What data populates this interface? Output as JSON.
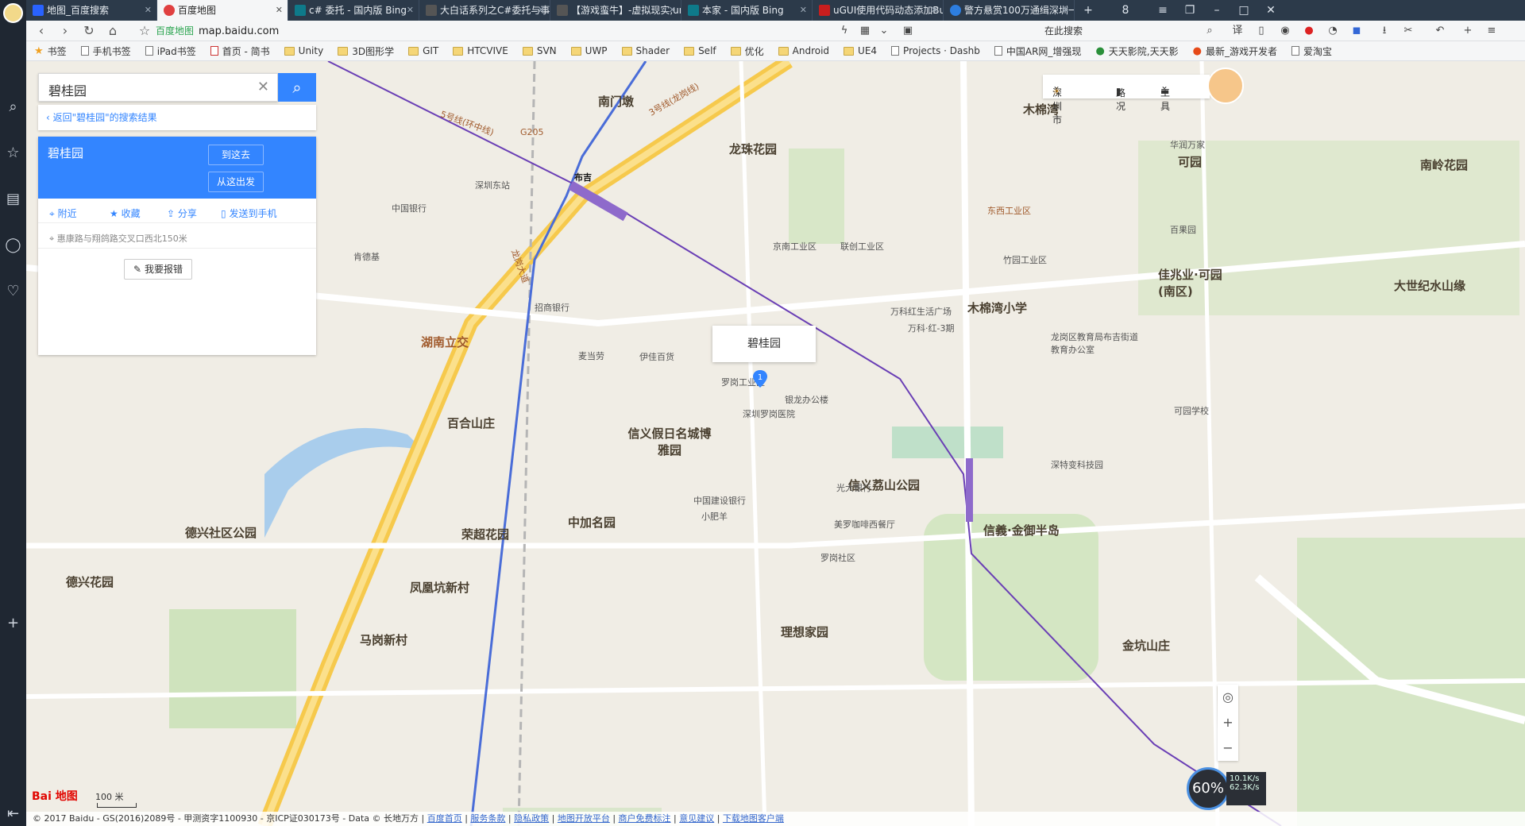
{
  "tabs": [
    {
      "label": "地图_百度搜索",
      "color": "#2962ff"
    },
    {
      "label": "百度地图",
      "color": "#e04040"
    },
    {
      "label": "c# 委托 - 国内版 Bing",
      "color": "#0e7a8a"
    },
    {
      "label": "大白话系列之C#委托与事件",
      "color": "#555555"
    },
    {
      "label": "【游戏蛮牛】-虚拟现实,unity",
      "color": "#555555"
    },
    {
      "label": "本家 - 国内版 Bing",
      "color": "#0e7a8a"
    },
    {
      "label": "uGUI使用代码动态添加Butt",
      "color": "#c81e1e"
    },
    {
      "label": "警方悬赏100万通缉深圳一名",
      "color": "#2d7ee0"
    }
  ],
  "tab_counter": "8",
  "address": {
    "site": "百度地图",
    "url": "map.baidu.com",
    "search_placeholder": "在此搜索"
  },
  "bookmarks": [
    "书签",
    "手机书签",
    "iPad书签",
    "首页 - 简书",
    "Unity",
    "3D图形学",
    "GIT",
    "HTCVIVE",
    "SVN",
    "UWP",
    "Shader",
    "Self",
    "优化",
    "Android",
    "UE4",
    "Projects · Dashb",
    "中国AR网_增强现",
    "天天影院,天天影",
    "最新_游戏开发者",
    "爱淘宝"
  ],
  "panel": {
    "search_value": "碧桂园",
    "back_link": "返回\"碧桂园\"的搜索结果",
    "place_name": "碧桂园",
    "btn_to": "到这去",
    "btn_from": "从这出发",
    "act_nearby": "附近",
    "act_fav": "收藏",
    "act_share": "分享",
    "act_send": "发送到手机",
    "address": "惠康路与翔鸽路交叉口西北150米",
    "report": "我要报错"
  },
  "tools": {
    "city": "深圳市",
    "traffic": "路况",
    "tools": "工具"
  },
  "bubble": {
    "title": "碧桂园",
    "marker": "1"
  },
  "map_labels": {
    "districts": [
      "南门墩",
      "龙珠花园",
      "木棉湾",
      "可园",
      "南岭花园",
      "佳兆业·可园(南区)",
      "大世纪水山缘",
      "木棉湾小学",
      "百合山庄",
      "信义假日名城博雅园",
      "信义荔山公园",
      "信義·金御半岛",
      "中加名园",
      "荣超花园",
      "德兴社区公园",
      "德兴花园",
      "凤凰坑新村",
      "马岗新村",
      "理想家园",
      "金坑山庄",
      "湖南立交"
    ],
    "pois": [
      "布吉",
      "深圳东站",
      "中国银行",
      "肯德基",
      "麦当劳",
      "招商银行",
      "伊佳百货",
      "深圳罗岗医院",
      "罗岗工业区",
      "银龙办公楼",
      "光大银行",
      "中国建设银行",
      "小肥羊",
      "美罗咖啡西餐厅",
      "罗岗社区",
      "深特变科技园",
      "龙岗区教育局布吉街道教育办公室",
      "可园学校",
      "华润万家",
      "百果园",
      "联创工业区",
      "京南工业区",
      "竹园工业区",
      "万科红生活广场",
      "万科·红-3期"
    ],
    "roads": [
      "5号线(环中线)",
      "3号线(龙岗线)",
      "龙岗大道",
      "G205",
      "东西工业区"
    ]
  },
  "speed": {
    "percent": "60%",
    "up": "10.1K/s",
    "down": "62.3K/s"
  },
  "scale": "100 米",
  "copyright": "© 2017 Baidu - GS(2016)2089号 - 甲测资字1100930 - 京ICP证030173号 - Data © 长地万方 |",
  "footer_links": [
    "百度首页",
    "服务条款",
    "隐私政策",
    "地图开放平台",
    "商户免费标注",
    "意见建议",
    "下载地图客户端"
  ],
  "logo": "Bai 地图",
  "colors": {
    "accent": "#3385ff",
    "metro": "#6a3fb5",
    "highway": "#f6c94c"
  }
}
